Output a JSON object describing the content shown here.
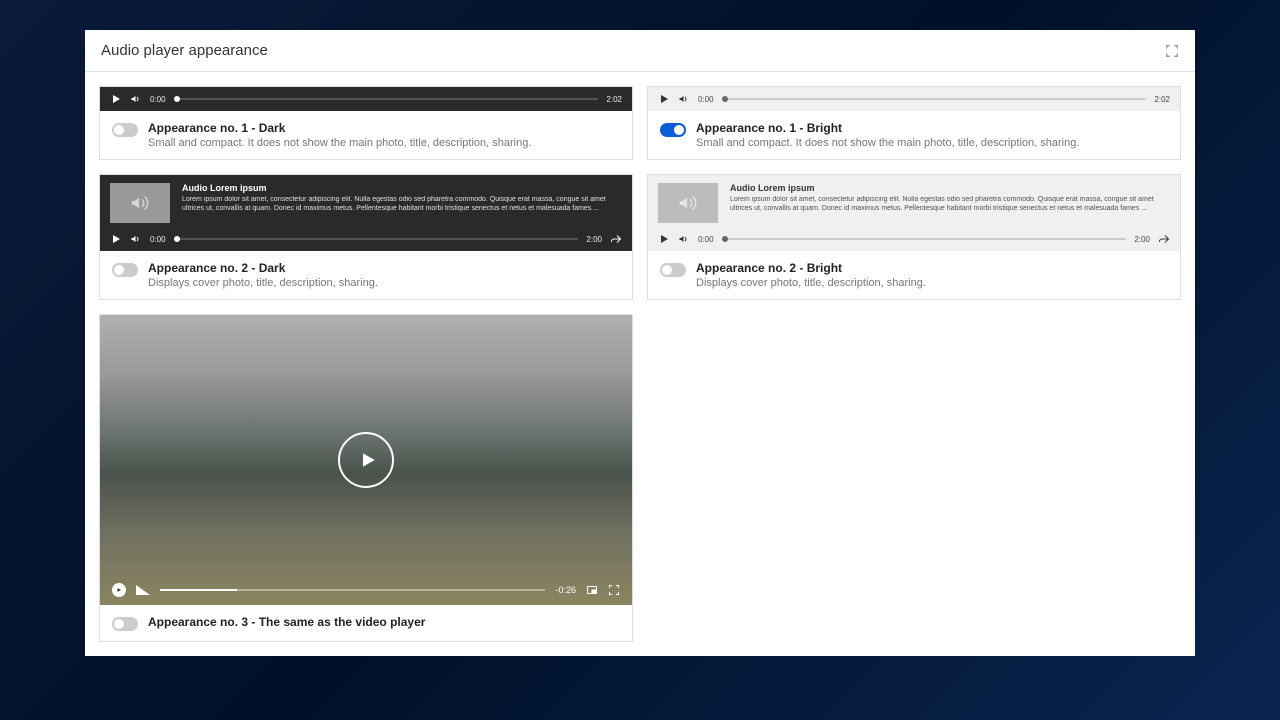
{
  "panel": {
    "title": "Audio player appearance"
  },
  "player": {
    "time_start": "0:00",
    "time_end": "2:02",
    "time_end_alt": "2:00",
    "meta_title": "Audio Lorem ipsum",
    "meta_desc": "Lorem ipsum dolor sit amet, consectetur adipiscing elit. Nulla egestas odio sed pharetra commodo. Quisque erat massa, congue sit amet ultrices ut, convallis at quam. Donec id maximus metus. Pellentesque habitant morbi tristique senectus et netus et malesuada fames ..."
  },
  "video": {
    "time": "-0:26"
  },
  "options": {
    "dark1": {
      "title": "Appearance no. 1 - Dark",
      "desc": "Small and compact. It does not show the main photo, title, description, sharing."
    },
    "bright1": {
      "title": "Appearance no. 1 - Bright",
      "desc": "Small and compact. It does not show the main photo, title, description, sharing."
    },
    "dark2": {
      "title": "Appearance no. 2 - Dark",
      "desc": "Displays cover photo, title, description, sharing."
    },
    "bright2": {
      "title": "Appearance no. 2 - Bright",
      "desc": "Displays cover photo, title, description, sharing."
    },
    "video": {
      "title": "Appearance no. 3 - The same as the video player"
    }
  }
}
